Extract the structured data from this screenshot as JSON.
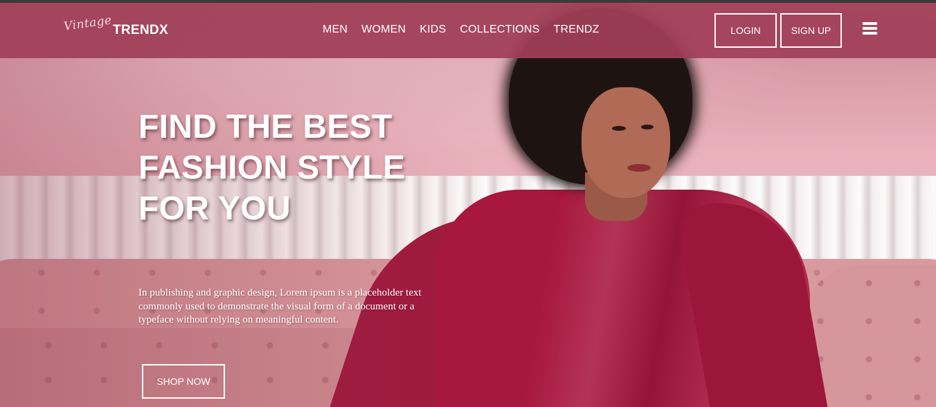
{
  "brand": {
    "script": "Vintage",
    "name": "TRENDX"
  },
  "nav": {
    "links": [
      "MEN",
      "WOMEN",
      "KIDS",
      "COLLECTIONS",
      "TRENDZ"
    ],
    "login_label": "LOGIN",
    "signup_label": "SIGN UP",
    "menu_icon": "hamburger-menu-icon"
  },
  "hero": {
    "title": "FIND THE BEST FASHION STYLE FOR YOU",
    "description": "In publishing and graphic design, Lorem ipsum is a placeholder text commonly used to demonstrate the visual form of a document or a typeface without relying on meaningful content.",
    "cta_label": "SHOP NOW"
  },
  "colors": {
    "navbar": "#a03e58",
    "dress": "#a8173e",
    "wall": "#e7aab4"
  }
}
